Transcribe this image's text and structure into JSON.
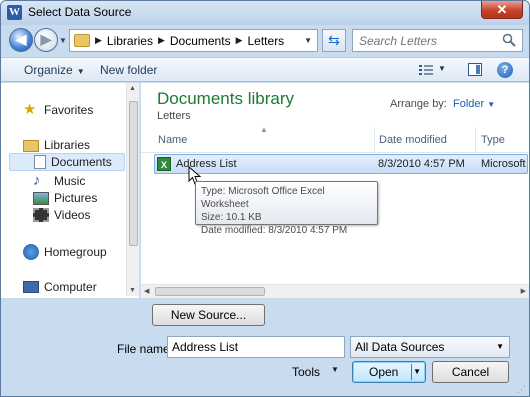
{
  "window": {
    "title": "Select Data Source",
    "app_icon": "W",
    "close_glyph": "✕"
  },
  "nav": {
    "breadcrumb": [
      "Libraries",
      "Documents",
      "Letters"
    ],
    "search_placeholder": "Search Letters"
  },
  "toolbar": {
    "organize": "Organize",
    "new_folder": "New folder"
  },
  "sidebar": {
    "favorites": "Favorites",
    "libraries": "Libraries",
    "documents": "Documents",
    "music": "Music",
    "pictures": "Pictures",
    "videos": "Videos",
    "homegroup": "Homegroup",
    "computer": "Computer"
  },
  "library": {
    "title": "Documents library",
    "subtitle": "Letters",
    "arrange_label": "Arrange by:",
    "arrange_value": "Folder"
  },
  "columns": {
    "name": "Name",
    "date": "Date modified",
    "type": "Type"
  },
  "file": {
    "name": "Address List",
    "date": "8/3/2010 4:57 PM",
    "type": "Microsoft"
  },
  "tooltip": {
    "line1": "Type: Microsoft Office Excel Worksheet",
    "line2": "Size: 10.1 KB",
    "line3": "Date modified: 8/3/2010 4:57 PM"
  },
  "bottom": {
    "new_source": "New Source...",
    "file_name_label": "File name:",
    "file_name_value": "Address List",
    "filter_value": "All Data Sources",
    "tools": "Tools",
    "open": "Open",
    "cancel": "Cancel"
  },
  "colors": {
    "accent": "#1e7a32",
    "link": "#1a5fb4",
    "chrome": "#c9dbef"
  }
}
